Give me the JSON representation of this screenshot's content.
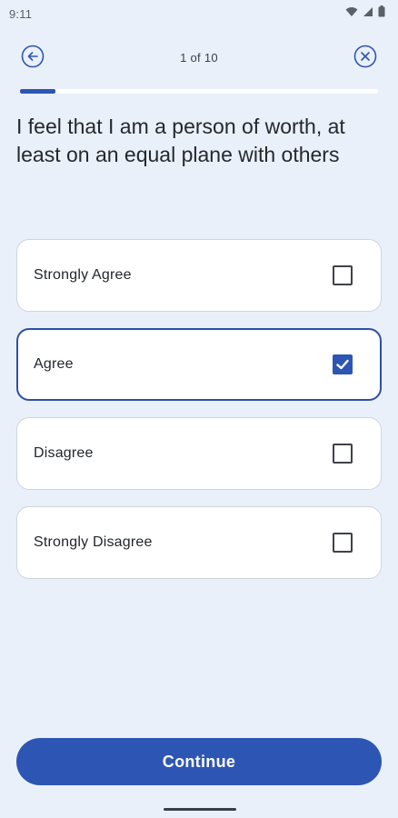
{
  "status_bar": {
    "time": "9:11",
    "icons": [
      "wifi-icon",
      "signal-icon",
      "battery-icon"
    ]
  },
  "header": {
    "back_icon": "arrow-left-circle-icon",
    "progress_label": "1 of 10",
    "close_icon": "close-circle-icon",
    "progress_fraction": 0.1
  },
  "question": "I feel that I am a person of worth, at least on an equal plane with others",
  "options": [
    {
      "label": "Strongly Agree",
      "checked": false
    },
    {
      "label": "Agree",
      "checked": true
    },
    {
      "label": "Disagree",
      "checked": false
    },
    {
      "label": "Strongly Disagree",
      "checked": false
    }
  ],
  "continue_label": "Continue",
  "colors": {
    "accent": "#2d55b3",
    "background": "#eaf0f9",
    "card": "#ffffff"
  }
}
